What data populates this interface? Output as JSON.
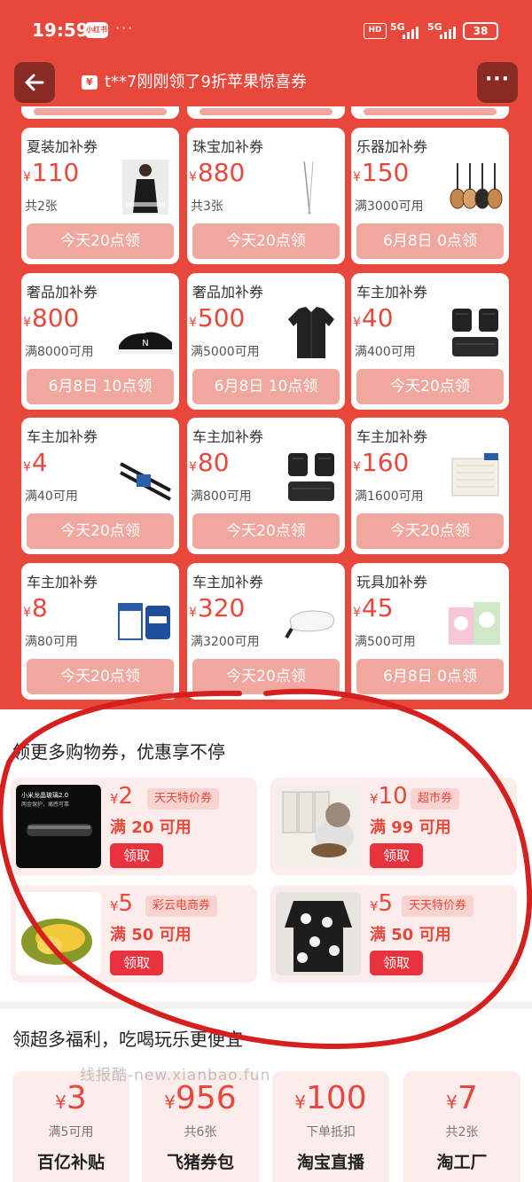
{
  "status_bar": {
    "time": "19:59",
    "app_badge": "小红书",
    "more": "···",
    "hd": "HD",
    "net1": "5G",
    "net2": "5G",
    "battery": "38"
  },
  "header": {
    "back_icon": "arrow-left-icon",
    "notice_icon": "ticket-icon",
    "notice": "t**7刚刚领了9折苹果惊喜券",
    "more": "···"
  },
  "coupons": [
    {
      "title": "夏装加补券",
      "currency": "¥",
      "amount": "110",
      "condition": "共2张",
      "button": "今天20点领",
      "image": "person-in-black-outfit"
    },
    {
      "title": "珠宝加补券",
      "currency": "¥",
      "amount": "880",
      "condition": "共3张",
      "button": "今天20点领",
      "image": "thin-necklace"
    },
    {
      "title": "乐器加补券",
      "currency": "¥",
      "amount": "150",
      "condition": "满3000可用",
      "button": "6月8日 0点领",
      "image": "guitars"
    },
    {
      "title": "奢品加补券",
      "currency": "¥",
      "amount": "800",
      "condition": "满8000可用",
      "button": "6月8日 10点领",
      "image": "black-sneaker"
    },
    {
      "title": "奢品加补券",
      "currency": "¥",
      "amount": "500",
      "condition": "满5000可用",
      "button": "6月8日 10点领",
      "image": "black-shirt"
    },
    {
      "title": "车主加补券",
      "currency": "¥",
      "amount": "40",
      "condition": "满400可用",
      "button": "今天20点领",
      "image": "car-floor-mats"
    },
    {
      "title": "车主加补券",
      "currency": "¥",
      "amount": "4",
      "condition": "满40可用",
      "button": "今天20点领",
      "image": "wiper-blades"
    },
    {
      "title": "车主加补券",
      "currency": "¥",
      "amount": "80",
      "condition": "满800可用",
      "button": "今天20点领",
      "image": "car-floor-mats"
    },
    {
      "title": "车主加补券",
      "currency": "¥",
      "amount": "160",
      "condition": "满1600可用",
      "button": "今天20点领",
      "image": "cabin-air-filter"
    },
    {
      "title": "车主加补券",
      "currency": "¥",
      "amount": "8",
      "condition": "满80可用",
      "button": "今天20点领",
      "image": "oil-filter-box"
    },
    {
      "title": "车主加补券",
      "currency": "¥",
      "amount": "320",
      "condition": "满3200可用",
      "button": "今天20点领",
      "image": "car-side-mirror"
    },
    {
      "title": "玩具加补券",
      "currency": "¥",
      "amount": "45",
      "condition": "满500可用",
      "button": "6月8日 0点领",
      "image": "toy-boxes"
    }
  ],
  "shopping_section": {
    "title": "领更多购物券，优惠享不停",
    "items": [
      {
        "currency": "¥",
        "amount": "2",
        "tag": "天天特价券",
        "condition": "满 20 可用",
        "button": "领取",
        "image": "phone-screen-protector"
      },
      {
        "currency": "¥",
        "amount": "10",
        "tag": "超市券",
        "condition": "满 99 可用",
        "button": "领取",
        "image": "cat-food"
      },
      {
        "currency": "¥",
        "amount": "5",
        "tag": "彩云电商券",
        "condition": "满 50 可用",
        "button": "领取",
        "image": "durian"
      },
      {
        "currency": "¥",
        "amount": "5",
        "tag": "天天特价券",
        "condition": "满 50 可用",
        "button": "领取",
        "image": "floral-sweater"
      }
    ],
    "thumb_text_1": "小米龙晶玻璃2.0",
    "thumb_text_2": "两金保护，痛感可靠"
  },
  "benefits_section": {
    "title": "领超多福利，吃喝玩乐更便宜",
    "items": [
      {
        "currency": "¥",
        "amount": "3",
        "condition": "满5可用",
        "name": "百亿补贴"
      },
      {
        "currency": "¥",
        "amount": "956",
        "condition": "共6张",
        "name": "飞猪券包"
      },
      {
        "currency": "¥",
        "amount": "100",
        "condition": "下单抵扣",
        "name": "淘宝直播"
      },
      {
        "currency": "¥",
        "amount": "7",
        "condition": "共2张",
        "name": "淘工厂"
      }
    ]
  },
  "watermark": "线报酷-new.xianbao.fun",
  "colors": {
    "brand_red": "#e8473b",
    "button_pink": "#f0a89e",
    "get_red": "#e8323e",
    "annotation_red": "#d61f1f"
  }
}
